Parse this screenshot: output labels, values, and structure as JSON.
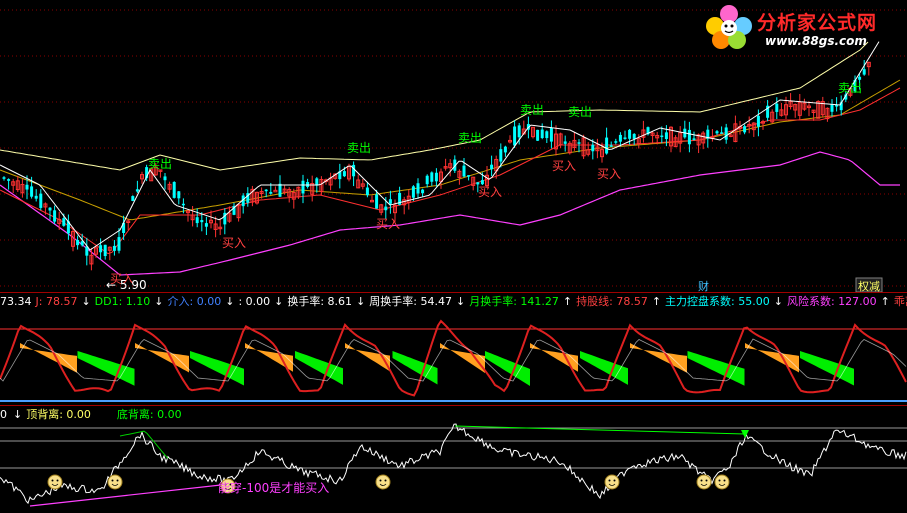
{
  "colors": {
    "bg": "#000000",
    "up": "#ff3232",
    "down": "#00ffff",
    "green_text": "#00ff00",
    "yellow": "#ffff66",
    "magenta": "#ff40ff",
    "blue": "#4aa0ff",
    "white": "#ffffff",
    "orange": "#ffa020",
    "grid": "#8b0000"
  },
  "logo": {
    "title": "分析家公式网",
    "url": "www.88gs.com",
    "icon": "flower-logo-icon"
  },
  "main": {
    "low_label": "← 5.90",
    "markers": [
      {
        "text": "卖出",
        "type": "sell"
      },
      {
        "text": "卖出",
        "type": "sell"
      },
      {
        "text": "卖出",
        "type": "sell"
      },
      {
        "text": "卖出",
        "type": "sell"
      },
      {
        "text": "卖出",
        "type": "sell"
      },
      {
        "text": "卖出",
        "type": "sell"
      },
      {
        "text": "买入",
        "type": "buy"
      },
      {
        "text": "买入",
        "type": "buy"
      },
      {
        "text": "买入",
        "type": "buy"
      },
      {
        "text": "买入",
        "type": "buy"
      },
      {
        "text": "买入",
        "type": "buy"
      },
      {
        "text": "买入",
        "type": "buy"
      }
    ],
    "badges": [
      "财",
      "权减"
    ]
  },
  "mid": {
    "indicators": [
      {
        "label": "73.34",
        "color": "#ffffff"
      },
      {
        "label": "J: 78.57",
        "color": "#ff4040",
        "arrow": "↓"
      },
      {
        "label": "DD1: 1.10",
        "color": "#00ff00",
        "arrow": "↓"
      },
      {
        "label": "介入: 0.00",
        "color": "#4080ff",
        "arrow": "↓"
      },
      {
        "label": ": 0.00",
        "color": "#ffffff",
        "arrow": "↓"
      },
      {
        "label": "换手率: 8.61",
        "color": "#ffffff",
        "arrow": "↓"
      },
      {
        "label": "周换手率: 54.47",
        "color": "#ffffff",
        "arrow": "↓"
      },
      {
        "label": "月换手率: 141.27",
        "color": "#00ff00",
        "arrow": "↑"
      },
      {
        "label": "持股线: 78.57",
        "color": "#ff4040",
        "arrow": "↑"
      },
      {
        "label": "主力控盘系数: 55.00",
        "color": "#00ffff",
        "arrow": "↓"
      },
      {
        "label": "风险系数: 127.00",
        "color": "#ff40ff",
        "arrow": "↑"
      },
      {
        "label": "乖离",
        "color": "#ff4040"
      }
    ]
  },
  "bot": {
    "indicators": [
      {
        "label": "0",
        "color": "#ffffff",
        "arrow": "↓"
      },
      {
        "label": "顶背离: 0.00",
        "color": "#ffff66"
      },
      {
        "label": "底背离: 0.00",
        "color": "#00ff00"
      }
    ],
    "note": "能穿-100是才能买入"
  }
}
